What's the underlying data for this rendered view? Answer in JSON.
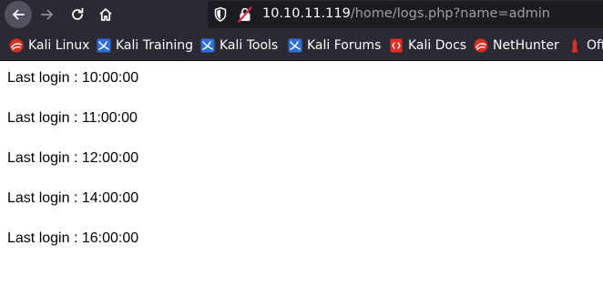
{
  "browser": {
    "url_host": "10.10.11.119",
    "url_path": "/home/logs.php?name=admin",
    "toolbar_icons": [
      "back-arrow-icon",
      "forward-arrow-icon",
      "reload-icon",
      "home-icon",
      "shield-icon",
      "insecure-lock-icon"
    ],
    "colors": {
      "toolbar": "#2b2a33",
      "urlbar": "#1c1b22",
      "text": "#fbfbfe",
      "path": "#9f9fa6",
      "kali_red": "#d93025",
      "kali_blue": "#2d6fd6"
    }
  },
  "bookmarks": [
    {
      "label": "Kali Linux",
      "icon": "kali-dragon-icon"
    },
    {
      "label": "Kali Training",
      "icon": "kali-training-icon"
    },
    {
      "label": "Kali Tools",
      "icon": "kali-tools-icon"
    },
    {
      "label": "Kali Forums",
      "icon": "kali-forums-icon"
    },
    {
      "label": "Kali Docs",
      "icon": "kali-docs-icon"
    },
    {
      "label": "NetHunter",
      "icon": "nethunter-icon"
    },
    {
      "label": "Offensive Security",
      "icon": "offsec-icon"
    }
  ],
  "page": {
    "logs": [
      "Last login : 10:00:00",
      "Last login : 11:00:00",
      "Last login : 12:00:00",
      "Last login : 14:00:00",
      "Last login : 16:00:00"
    ]
  }
}
